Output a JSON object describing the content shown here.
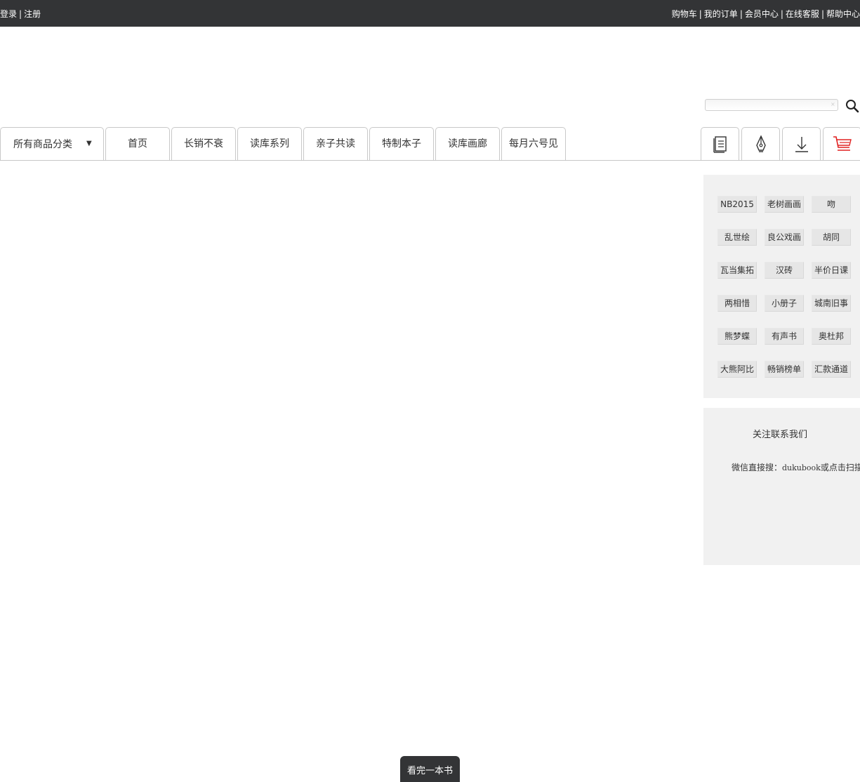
{
  "topbar": {
    "login": "登录",
    "register": "注册",
    "separator": "|",
    "right_links": [
      "购物车",
      "我的订单",
      "会员中心",
      "在线客服",
      "帮助中心"
    ]
  },
  "search": {
    "placeholder": "",
    "value": ""
  },
  "nav": {
    "category_label": "所有商品分类",
    "category_arrow": "▼",
    "tabs": [
      "首页",
      "长销不衰",
      "读库系列",
      "亲子共读",
      "特制本子",
      "读库画廊",
      "每月六号见"
    ],
    "icons": [
      "catalog-icon",
      "pen-icon",
      "download-icon",
      "cart-icon"
    ],
    "cart_color": "#e02020"
  },
  "tags": [
    [
      "NB2015",
      "老树画画",
      "吻"
    ],
    [
      "乱世绘",
      "良公戏画",
      "胡同"
    ],
    [
      "瓦当集拓",
      "汉砖",
      "半价日课"
    ],
    [
      "两相惜",
      "小册子",
      "城南旧事"
    ],
    [
      "熊梦蝶",
      "有声书",
      "奥杜邦"
    ],
    [
      "大熊阿比",
      "畅销榜单",
      "汇款通道"
    ]
  ],
  "contact": {
    "title": "关注联系我们",
    "text_prefix": "微信直接搜：",
    "wechat_id": "dukubook",
    "text_suffix": "或点击扫描二维码"
  },
  "float_button": {
    "label": "看完一本书"
  },
  "colors": {
    "topbar_bg": "#333436",
    "panel_bg": "#f1f1f1"
  }
}
